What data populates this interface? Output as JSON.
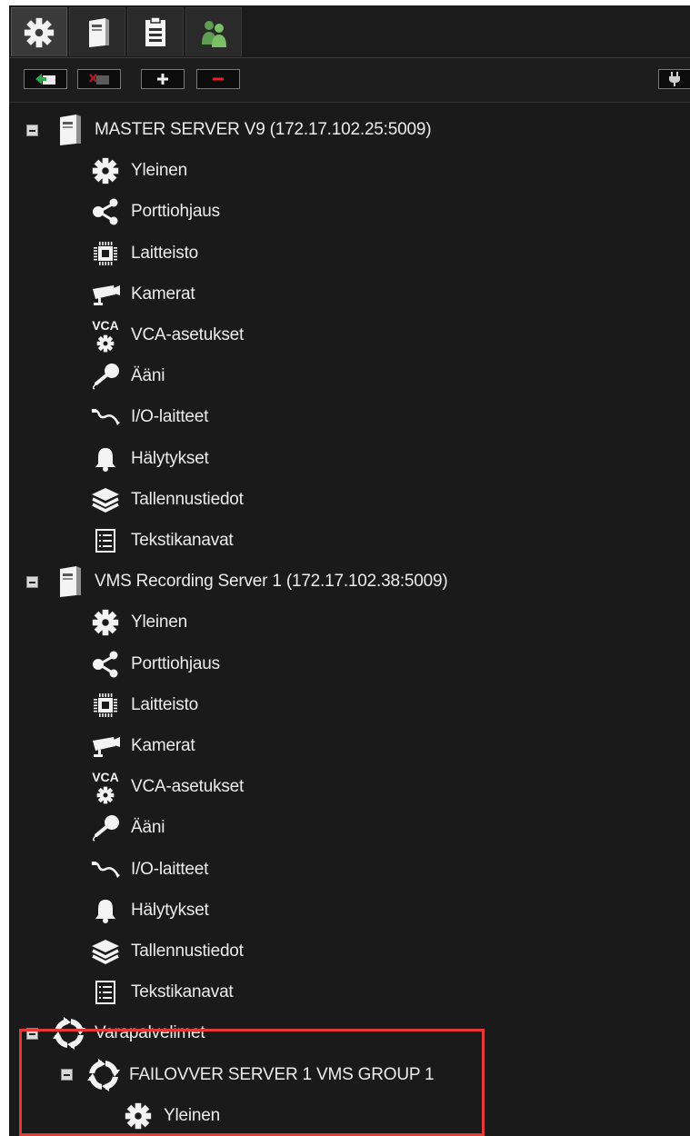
{
  "tabs": [
    {
      "icon": "gear-icon"
    },
    {
      "icon": "server-icon"
    },
    {
      "icon": "document-list-icon"
    },
    {
      "icon": "users-icon"
    }
  ],
  "toolbar": {
    "buttons": [
      {
        "icon": "add-server-icon"
      },
      {
        "icon": "remove-server-icon"
      },
      {
        "icon": "plus-icon"
      },
      {
        "icon": "minus-icon"
      }
    ],
    "right_button": {
      "icon": "plug-icon"
    }
  },
  "servers": [
    {
      "label": "MASTER SERVER V9 (172.17.102.25:5009)",
      "icon": "server-icon",
      "children": [
        {
          "label": "Yleinen",
          "icon": "gear-icon"
        },
        {
          "label": "Porttiohjaus",
          "icon": "share-icon"
        },
        {
          "label": "Laitteisto",
          "icon": "chip-icon"
        },
        {
          "label": "Kamerat",
          "icon": "camera-icon"
        },
        {
          "label": "VCA-asetukset",
          "icon": "vca-icon",
          "icon_text": "VCA"
        },
        {
          "label": "Ääni",
          "icon": "microphone-icon"
        },
        {
          "label": "I/O-laitteet",
          "icon": "io-cable-icon"
        },
        {
          "label": "Hälytykset",
          "icon": "bell-icon"
        },
        {
          "label": "Tallennustiedot",
          "icon": "layers-icon"
        },
        {
          "label": "Tekstikanavat",
          "icon": "text-list-icon"
        }
      ]
    },
    {
      "label": "VMS Recording Server 1 (172.17.102.38:5009)",
      "icon": "server-icon",
      "children": [
        {
          "label": "Yleinen",
          "icon": "gear-icon"
        },
        {
          "label": "Porttiohjaus",
          "icon": "share-icon"
        },
        {
          "label": "Laitteisto",
          "icon": "chip-icon"
        },
        {
          "label": "Kamerat",
          "icon": "camera-icon"
        },
        {
          "label": "VCA-asetukset",
          "icon": "vca-icon",
          "icon_text": "VCA"
        },
        {
          "label": "Ääni",
          "icon": "microphone-icon"
        },
        {
          "label": "I/O-laitteet",
          "icon": "io-cable-icon"
        },
        {
          "label": "Hälytykset",
          "icon": "bell-icon"
        },
        {
          "label": "Tallennustiedot",
          "icon": "layers-icon"
        },
        {
          "label": "Tekstikanavat",
          "icon": "text-list-icon"
        }
      ]
    }
  ],
  "failover": {
    "label": "Varapalvelimet",
    "icon": "failover-icon",
    "group": {
      "label": "FAILOVVER SERVER 1 VMS GROUP 1",
      "icon": "failover-icon",
      "children": [
        {
          "label": "Yleinen",
          "icon": "gear-icon"
        }
      ]
    }
  },
  "colors": {
    "background": "#1a1a1a",
    "text": "#ececec",
    "highlight": "#e53935",
    "add_green": "#2ea84a",
    "remove_red": "#e0202a"
  }
}
